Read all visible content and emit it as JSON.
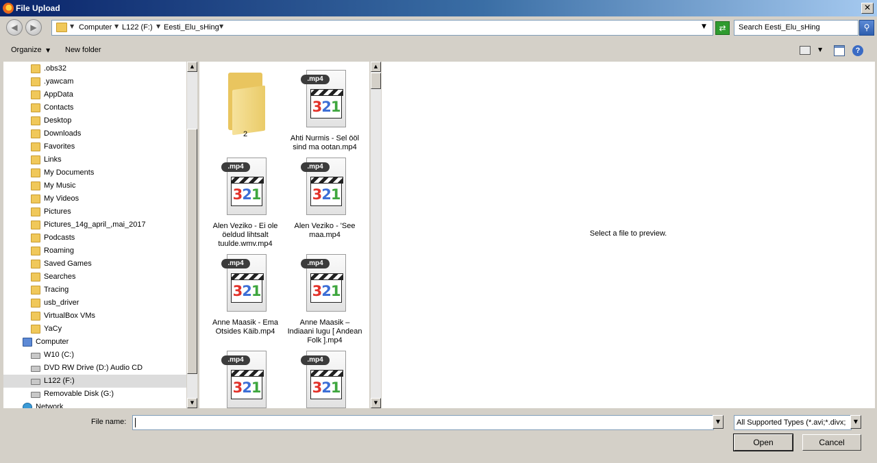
{
  "window": {
    "title": "File Upload"
  },
  "address": {
    "crumbs": [
      "Computer",
      "L122 (F:)",
      "Eesti_Elu_sHing"
    ]
  },
  "search": {
    "value": "Search Eesti_Elu_sHing"
  },
  "toolbar": {
    "organize": "Organize",
    "new_folder": "New folder"
  },
  "nav_tree": [
    {
      "label": ".obs32",
      "icon": "folder-icon"
    },
    {
      "label": ".yawcam",
      "icon": "folder-icon"
    },
    {
      "label": "AppData",
      "icon": "folder-icon"
    },
    {
      "label": "Contacts",
      "icon": "folder-icon"
    },
    {
      "label": "Desktop",
      "icon": "folder-icon"
    },
    {
      "label": "Downloads",
      "icon": "folder-icon"
    },
    {
      "label": "Favorites",
      "icon": "folder-icon"
    },
    {
      "label": "Links",
      "icon": "folder-icon"
    },
    {
      "label": "My Documents",
      "icon": "folder-icon"
    },
    {
      "label": "My Music",
      "icon": "folder-icon"
    },
    {
      "label": "My Videos",
      "icon": "folder-icon"
    },
    {
      "label": "Pictures",
      "icon": "folder-icon"
    },
    {
      "label": "Pictures_14g_april_,mai_2017",
      "icon": "folder-icon"
    },
    {
      "label": "Podcasts",
      "icon": "folder-icon"
    },
    {
      "label": "Roaming",
      "icon": "folder-icon"
    },
    {
      "label": "Saved Games",
      "icon": "folder-icon"
    },
    {
      "label": "Searches",
      "icon": "folder-icon"
    },
    {
      "label": "Tracing",
      "icon": "folder-icon"
    },
    {
      "label": "usb_driver",
      "icon": "folder-icon"
    },
    {
      "label": "VirtualBox VMs",
      "icon": "folder-icon"
    },
    {
      "label": "YaCy",
      "icon": "folder-icon"
    },
    {
      "label": "Computer",
      "icon": "computer-icon"
    },
    {
      "label": "W10 (C:)",
      "icon": "drive-icon"
    },
    {
      "label": "DVD RW Drive (D:) Audio CD",
      "icon": "dvd-drive-icon"
    },
    {
      "label": "L122 (F:)",
      "icon": "drive-icon",
      "selected": true
    },
    {
      "label": "Removable Disk (G:)",
      "icon": "drive-icon"
    },
    {
      "label": "Network",
      "icon": "network-icon"
    }
  ],
  "files": [
    {
      "name": "2",
      "type": "folder"
    },
    {
      "name": "Ahti Nurmis - Sel ööl sind ma ootan.mp4",
      "type": "mp4"
    },
    {
      "name": "Alen Veziko - Ei ole öeldud lihtsalt tuulde.wmv.mp4",
      "type": "mp4"
    },
    {
      "name": "Alen Veziko - 'See maa.mp4",
      "type": "mp4"
    },
    {
      "name": "Anne Maasik - Ema Otsides Käib.mp4",
      "type": "mp4"
    },
    {
      "name": "Anne Maasik – Indiaani lugu [ Andean Folk ].mp4",
      "type": "mp4"
    },
    {
      "name": "",
      "type": "mp4"
    },
    {
      "name": "",
      "type": "mp4"
    }
  ],
  "mp4_tag": ".mp4",
  "preview": {
    "message": "Select a file to preview."
  },
  "bottom": {
    "filename_label": "File name:",
    "filename_value": "",
    "filetype": "All Supported Types (*.avi;*.divx;",
    "open": "Open",
    "cancel": "Cancel"
  }
}
